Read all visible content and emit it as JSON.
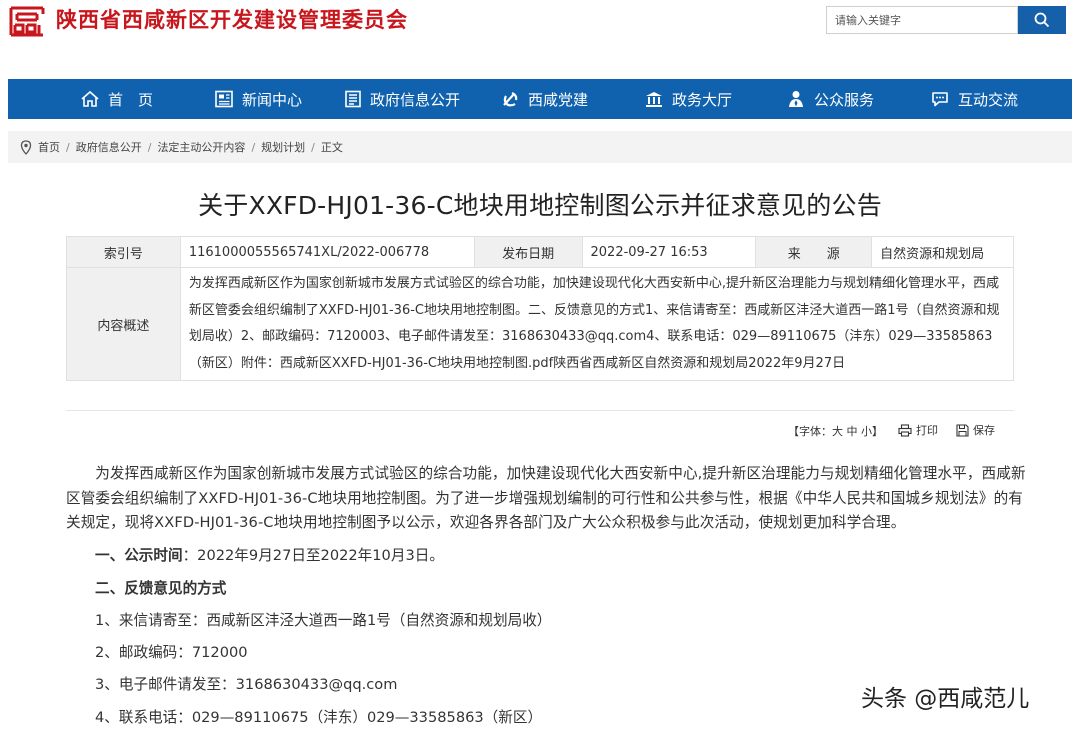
{
  "header": {
    "site_title": "陕西省西咸新区开发建设管理委员会",
    "search_placeholder": "请输入关键字"
  },
  "nav": {
    "items": [
      {
        "label": "首　页",
        "icon": "home-icon"
      },
      {
        "label": "新闻中心",
        "icon": "newspaper-icon"
      },
      {
        "label": "政府信息公开",
        "icon": "document-list-icon"
      },
      {
        "label": "西咸党建",
        "icon": "party-emblem-icon"
      },
      {
        "label": "政务大厅",
        "icon": "government-building-icon"
      },
      {
        "label": "公众服务",
        "icon": "person-service-icon"
      },
      {
        "label": "互动交流",
        "icon": "chat-icon"
      }
    ]
  },
  "breadcrumb": [
    "首页",
    "政府信息公开",
    "法定主动公开内容",
    "规划计划",
    "正文"
  ],
  "article": {
    "title": "关于XXFD-HJ01-36-C地块用地控制图公示并征求意见的公告",
    "info": {
      "index_label": "索引号",
      "index_value": "1161000055565741XL/2022-006778",
      "date_label": "发布日期",
      "date_value": "2022-09-27 16:53",
      "source_label": "来　　源",
      "source_value": "自然资源和规划局",
      "summary_label": "内容概述",
      "summary_value": "为发挥西咸新区作为国家创新城市发展方式试验区的综合功能，加快建设现代化大西安新中心,提升新区治理能力与规划精细化管理水平，西咸新区管委会组织编制了XXFD-HJ01-36-C地块用地控制图。二、反馈意见的方式1、来信请寄至：西咸新区沣泾大道西一路1号（自然资源和规划局收）2、邮政编码：7120003、电子邮件请发至：3168630433@qq.com4、联系电话：029—89110675（沣东）029—33585863（新区）附件：西咸新区XXFD-HJ01-36-C地块用地控制图.pdf陕西省西咸新区自然资源和规划局2022年9月27日"
    },
    "tools": {
      "font_prefix": "【字体：",
      "font_large": "大",
      "font_medium": "中",
      "font_small": "小",
      "font_suffix": "】",
      "print": "打印",
      "save": "保存"
    },
    "body": {
      "intro": "为发挥西咸新区作为国家创新城市发展方式试验区的综合功能，加快建设现代化大西安新中心,提升新区治理能力与规划精细化管理水平，西咸新区管委会组织编制了XXFD-HJ01-36-C地块用地控制图。为了进一步增强规划编制的可行性和公共参与性，根据《中华人民共和国城乡规划法》的有关规定，现将XXFD-HJ01-36-C地块用地控制图予以公示，欢迎各界各部门及广大公众积极参与此次活动，使规划更加科学合理。",
      "s1_heading": "一、公示时间",
      "s1_text": "：2022年9月27日至2022年10月3日。",
      "s2_heading": "二、反馈意见的方式",
      "item1": "1、来信请寄至：西咸新区沣泾大道西一路1号（自然资源和规划局收）",
      "item2": "2、邮政编码：712000",
      "item3": "3、电子邮件请发至：3168630433@qq.com",
      "item4": "4、联系电话：029—89110675（沣东）029—33585863（新区）"
    }
  },
  "watermark": "头条 @西咸范儿",
  "colors": {
    "brand_red": "#c8161d",
    "nav_blue": "#1162ae",
    "search_blue": "#1560a9"
  }
}
